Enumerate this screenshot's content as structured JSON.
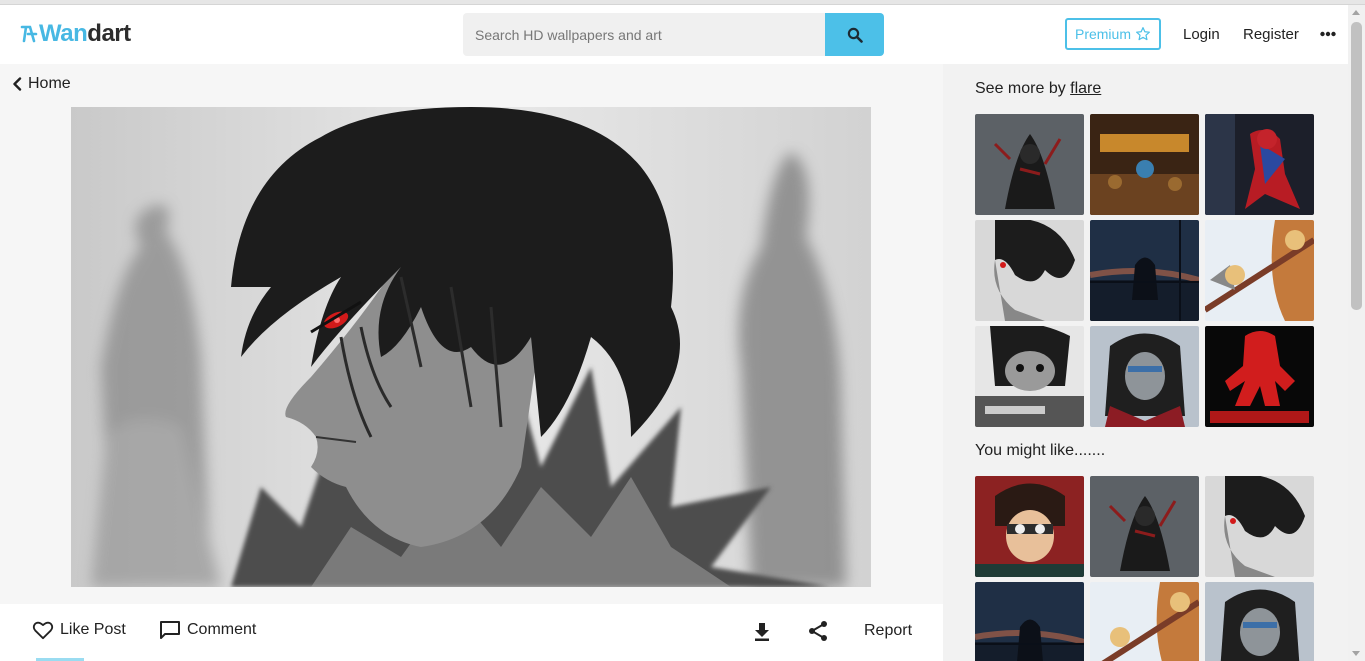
{
  "header": {
    "logo": {
      "mark": "icon",
      "accent": "Wan",
      "rest": "dart"
    },
    "search_placeholder": "Search HD wallpapers and art",
    "premium_label": "Premium",
    "login_label": "Login",
    "register_label": "Register"
  },
  "main": {
    "back_label": "Home",
    "artwork_alt": "flare artwork"
  },
  "actions": {
    "like_label": "Like Post",
    "comment_label": "Comment",
    "report_label": "Report"
  },
  "sidebar": {
    "see_more_prefix": "See more by ",
    "author": "flare",
    "you_might_like": "You might like......."
  },
  "colors": {
    "accent": "#4cc0e8",
    "brand_dark": "#2d2d2d"
  },
  "icons": [
    "search-icon",
    "star-icon",
    "more-icon",
    "chevron-left-icon",
    "heart-icon",
    "comment-icon",
    "download-icon",
    "share-icon"
  ]
}
